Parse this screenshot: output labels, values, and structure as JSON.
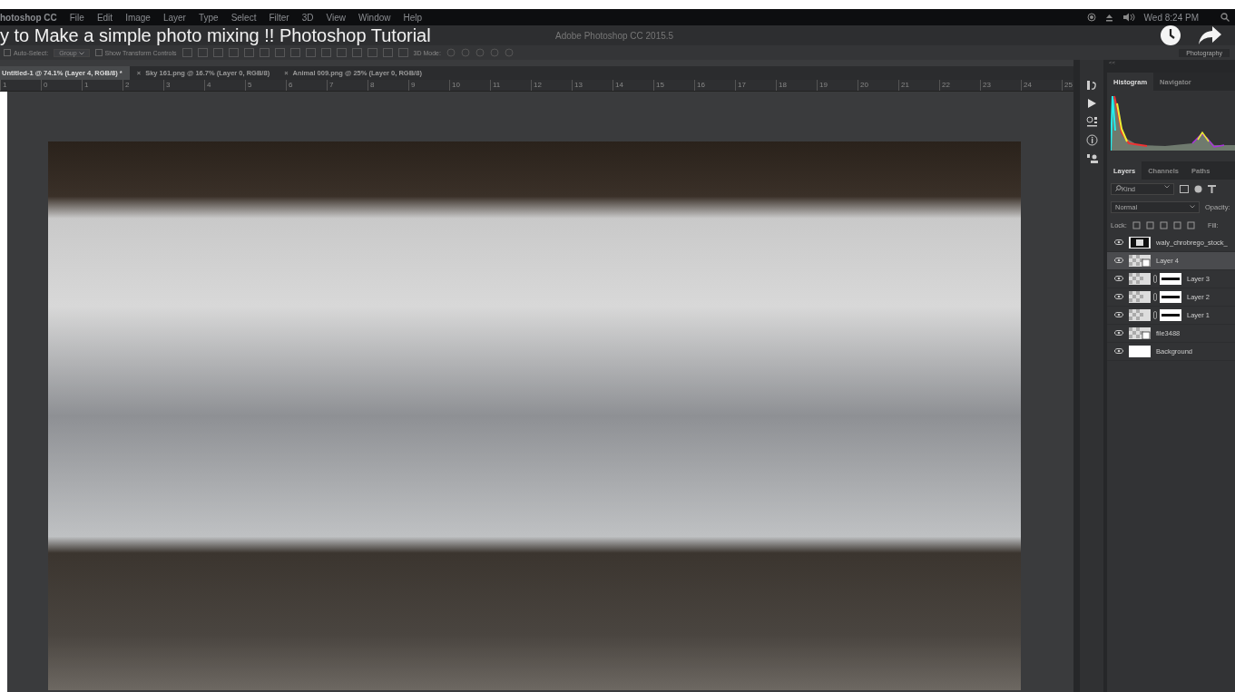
{
  "video": {
    "title": "y to Make a simple photo mixing !! Photoshop Tutorial"
  },
  "menu": [
    "hotoshop CC",
    "File",
    "Edit",
    "Image",
    "Layer",
    "Type",
    "Select",
    "Filter",
    "3D",
    "View",
    "Window",
    "Help"
  ],
  "status": {
    "time": "Wed 8:24 PM"
  },
  "app_title": "Adobe Photoshop CC 2015.5",
  "options": {
    "auto_select": {
      "label": "Auto-Select:",
      "checked": false
    },
    "group": "Group",
    "show_transform": {
      "label": "Show Transform Controls",
      "checked": false
    },
    "mode_3d": "3D Mode:",
    "workspace": "Photography"
  },
  "doc_tabs": [
    {
      "label": "Untitled-1 @ 74.1% (Layer 4, RGB/8) *",
      "selected": true
    },
    {
      "label": "Sky 161.png @ 16.7% (Layer 0, RGB/8)",
      "selected": false
    },
    {
      "label": "Animal 009.png @ 25% (Layer 0, RGB/8)",
      "selected": false
    }
  ],
  "close_glyph": "×",
  "ruler": [
    "1",
    "0",
    "1",
    "2",
    "3",
    "4",
    "5",
    "6",
    "7",
    "8",
    "9",
    "10",
    "11",
    "12",
    "13",
    "14",
    "15",
    "16",
    "17",
    "18",
    "19",
    "20",
    "21",
    "22",
    "23",
    "24",
    "25"
  ],
  "panel": {
    "collapse": "<<",
    "top_tabs": [
      {
        "label": "Histogram",
        "selected": true
      },
      {
        "label": "Navigator",
        "selected": false
      }
    ],
    "tabs": [
      {
        "label": "Layers",
        "selected": true
      },
      {
        "label": "Channels",
        "selected": false
      },
      {
        "label": "Paths",
        "selected": false
      }
    ],
    "filter": "Kind",
    "blend": "Normal",
    "opacity_label": "Opacity:",
    "lock_label": "Lock:",
    "fill_label": "Fill:",
    "layers": [
      {
        "name": "waly_chrobrego_stock_",
        "kind": "frame",
        "visible": true,
        "selected": false
      },
      {
        "name": "Layer 4",
        "kind": "smart",
        "visible": true,
        "selected": true
      },
      {
        "name": "Layer 3",
        "kind": "masked",
        "visible": true,
        "selected": false
      },
      {
        "name": "Layer 2",
        "kind": "masked",
        "visible": true,
        "selected": false
      },
      {
        "name": "Layer 1",
        "kind": "masked",
        "visible": true,
        "selected": false
      },
      {
        "name": "file3488",
        "kind": "smart",
        "visible": true,
        "selected": false
      },
      {
        "name": "Background",
        "kind": "plain",
        "visible": true,
        "selected": false
      }
    ]
  }
}
